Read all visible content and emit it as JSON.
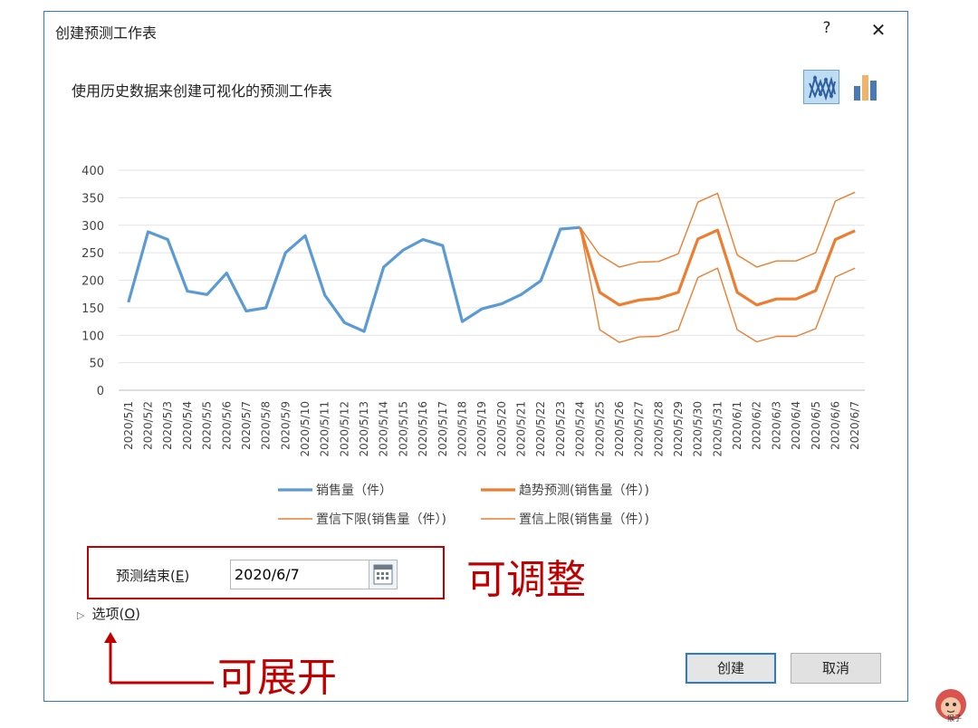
{
  "dialog": {
    "title": "创建预测工作表",
    "help_label": "?",
    "close_label": "✕",
    "subtitle": "使用历史数据来创建可视化的预测工作表",
    "chart_type_buttons": [
      "line-chart-icon",
      "column-chart-icon"
    ]
  },
  "chart_data": {
    "type": "line",
    "categories": [
      "2020/5/1",
      "2020/5/2",
      "2020/5/3",
      "2020/5/4",
      "2020/5/5",
      "2020/5/6",
      "2020/5/7",
      "2020/5/8",
      "2020/5/9",
      "2020/5/10",
      "2020/5/11",
      "2020/5/12",
      "2020/5/13",
      "2020/5/14",
      "2020/5/15",
      "2020/5/16",
      "2020/5/17",
      "2020/5/18",
      "2020/5/19",
      "2020/5/20",
      "2020/5/21",
      "2020/5/22",
      "2020/5/23",
      "2020/5/24",
      "2020/5/25",
      "2020/5/26",
      "2020/5/27",
      "2020/5/28",
      "2020/5/29",
      "2020/5/30",
      "2020/5/31",
      "2020/6/1",
      "2020/6/2",
      "2020/6/3",
      "2020/6/4",
      "2020/6/5",
      "2020/6/6",
      "2020/6/7"
    ],
    "ylim": [
      0,
      400
    ],
    "yticks": [
      0,
      50,
      100,
      150,
      200,
      250,
      300,
      350,
      400
    ],
    "grid": true,
    "legend_position": "bottom",
    "series": [
      {
        "name": "销售量（件）",
        "color": "#5b9bd5",
        "width": "thick",
        "start": 0,
        "values": [
          160,
          288,
          274,
          180,
          174,
          213,
          144,
          150,
          250,
          281,
          173,
          123,
          107,
          224,
          255,
          274,
          263,
          125,
          148,
          157,
          174,
          199,
          293,
          296
        ]
      },
      {
        "name": "趋势预测(销售量（件）)",
        "color": "#ed7d31",
        "width": "thick",
        "start": 23,
        "values": [
          296,
          178,
          155,
          164,
          167,
          178,
          275,
          291,
          178,
          155,
          166,
          166,
          181,
          274,
          290
        ]
      },
      {
        "name": "置信下限(销售量（件）)",
        "color": "#ed7d31",
        "width": "thin",
        "start": 23,
        "values": [
          296,
          110,
          87,
          97,
          98,
          110,
          205,
          222,
          110,
          88,
          98,
          98,
          112,
          206,
          222
        ]
      },
      {
        "name": "置信上限(销售量（件）)",
        "color": "#ed7d31",
        "width": "thin",
        "start": 23,
        "values": [
          296,
          246,
          224,
          233,
          234,
          248,
          342,
          358,
          246,
          224,
          235,
          235,
          250,
          344,
          360
        ]
      }
    ]
  },
  "forecast_end": {
    "label": "预测结束(",
    "accel": "E",
    "label_tail": ")",
    "value": "2020/6/7"
  },
  "options": {
    "label": "选项(",
    "accel": "O",
    "label_tail": ")"
  },
  "buttons": {
    "create": "创建",
    "cancel": "取消"
  },
  "annotations": {
    "adjustable": "可调整",
    "expandable": "可展开"
  },
  "watermark": {
    "text": "猴子"
  },
  "colors": {
    "accent": "#2b78d8",
    "annotation_red": "#c00000"
  }
}
